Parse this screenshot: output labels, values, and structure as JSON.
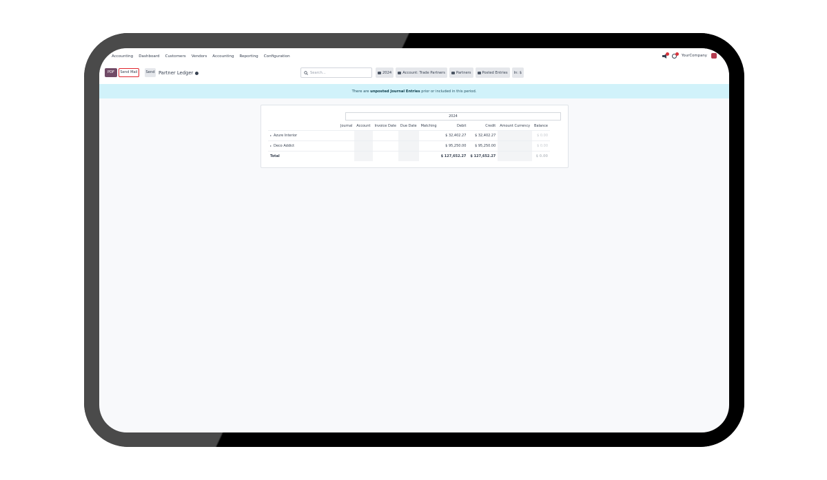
{
  "navbar": {
    "menu": [
      "Accounting",
      "Dashboard",
      "Customers",
      "Vendors",
      "Accounting",
      "Reporting",
      "Configuration"
    ],
    "company": "YourCompany"
  },
  "controls": {
    "pdf_label": "PDF",
    "send_mail_label": "Send Mail",
    "send_label": "Send",
    "title": "Partner Ledger",
    "search_placeholder": "Search...",
    "filters": [
      "2024",
      "Account: Trade Partners",
      "Partners",
      "Posted Entries",
      "In: $"
    ]
  },
  "banner": {
    "prefix": "There are",
    "link": "unposted Journal Entries",
    "suffix": "prior or included in this period."
  },
  "report": {
    "period": "2024",
    "columns": [
      "Journal",
      "Account",
      "Invoice Date",
      "Due Date",
      "Matching",
      "Debit",
      "Credit",
      "Amount Currency",
      "Balance"
    ],
    "rows": [
      {
        "name": "Azure Interior",
        "debit": "$ 32,402.27",
        "credit": "$ 32,402.27",
        "balance": "$ 0.00"
      },
      {
        "name": "Deco Addict",
        "debit": "$ 95,250.00",
        "credit": "$ 95,250.00",
        "balance": "$ 0.00"
      }
    ],
    "total": {
      "name": "Total",
      "debit": "$ 127,652.27",
      "credit": "$ 127,652.27",
      "balance": "$ 0.00"
    }
  },
  "colors": {
    "brand": "#714b67",
    "highlight": "#e0222b",
    "banner": "#d1f2fa"
  }
}
